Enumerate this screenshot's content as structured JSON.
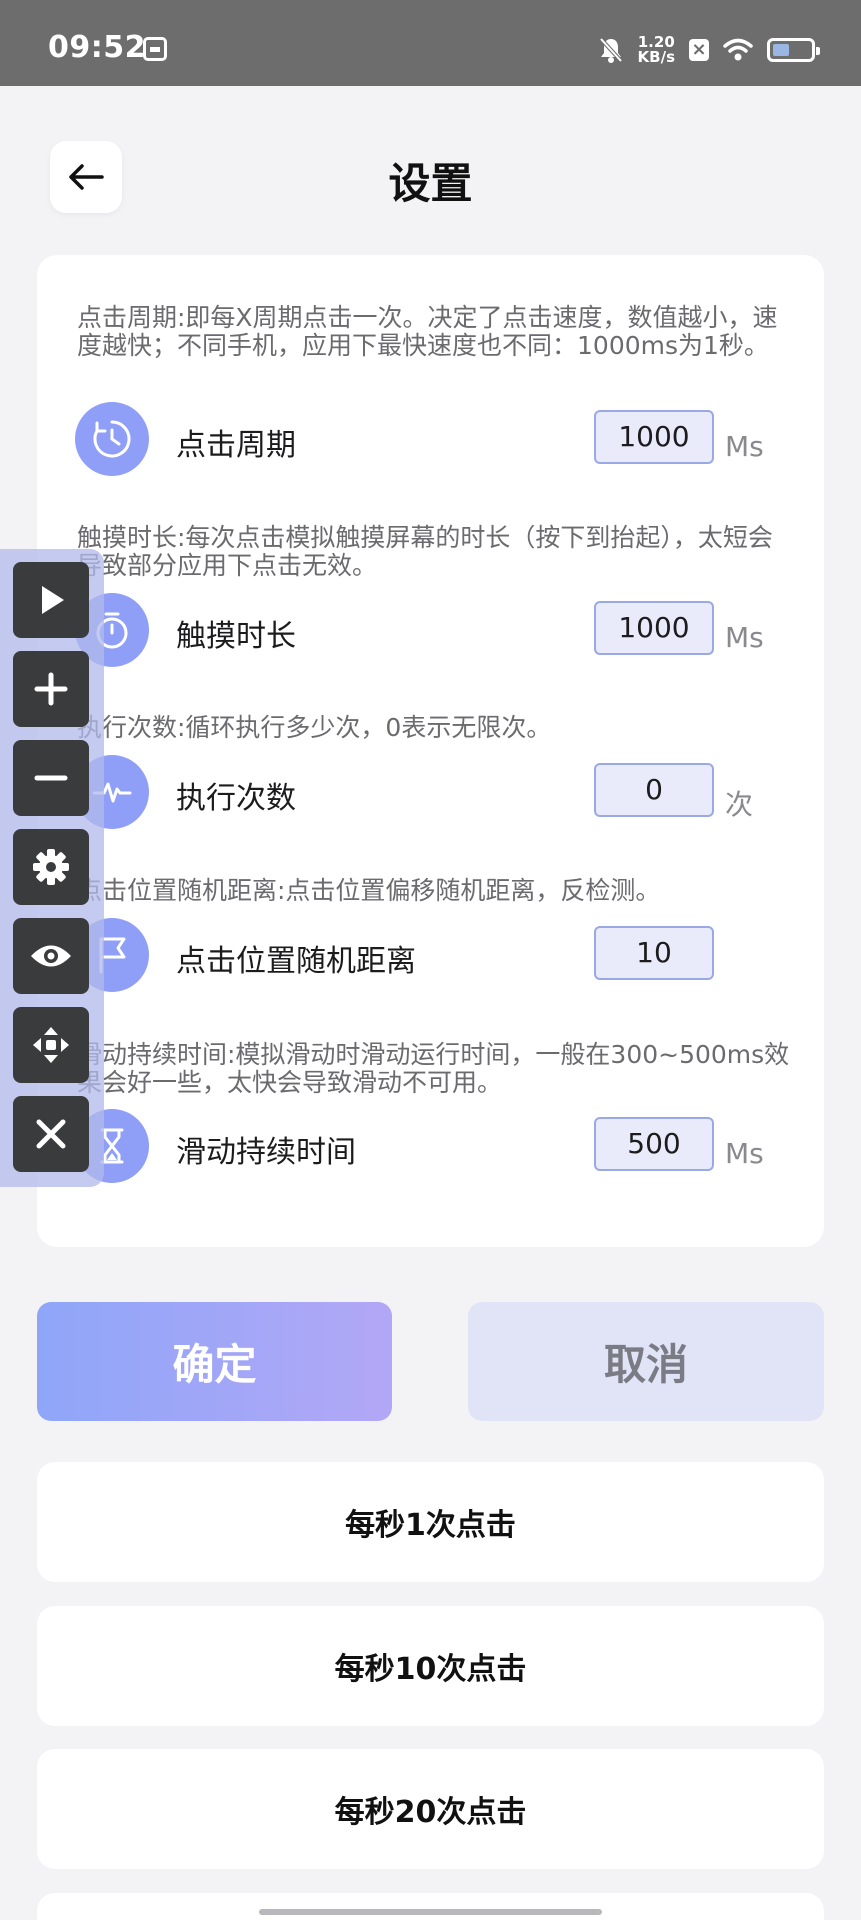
{
  "status_bar": {
    "time": "09:52",
    "net_speed_value": "1.20",
    "net_speed_unit": "KB/s",
    "x_badge": "×",
    "icons": [
      "calendar-icon",
      "bell-off-icon",
      "x-badge-icon",
      "wifi-icon",
      "battery-icon"
    ]
  },
  "header": {
    "back_icon": "arrow-left-icon",
    "title": "设置"
  },
  "settings": [
    {
      "description": "点击周期:即每X周期点击一次。决定了点击速度，数值越小，速度越快；不同手机，应用下最快速度也不同：1000ms为1秒。",
      "icon": "clock-cycle-icon",
      "label": "点击周期",
      "value": "1000",
      "unit": "Ms"
    },
    {
      "description": "触摸时长:每次点击模拟触摸屏幕的时长（按下到抬起），太短会导致部分应用下点击无效。",
      "icon": "stopwatch-icon",
      "label": "触摸时长",
      "value": "1000",
      "unit": "Ms"
    },
    {
      "description": "执行次数:循环执行多少次，0表示无限次。",
      "icon": "pulse-icon",
      "label": "执行次数",
      "value": "0",
      "unit": "次"
    },
    {
      "description": "点击位置随机距离:点击位置偏移随机距离，反检测。",
      "icon": "flag-icon",
      "label": "点击位置随机距离",
      "value": "10",
      "unit": ""
    },
    {
      "description": "滑动持续时间:模拟滑动时滑动运行时间，一般在300~500ms效果会好一些，太快会导致滑动不可用。",
      "icon": "hourglass-icon",
      "label": "滑动持续时间",
      "value": "500",
      "unit": "Ms"
    }
  ],
  "float_toolbar": [
    "play-icon",
    "plus-icon",
    "minus-icon",
    "gear-icon",
    "eye-icon",
    "move-icon",
    "close-icon"
  ],
  "actions": {
    "confirm": "确定",
    "cancel": "取消"
  },
  "presets": [
    "每秒1次点击",
    "每秒10次点击",
    "每秒20次点击"
  ],
  "colors": {
    "accent": "#8f9ff7",
    "confirm_gradient_start": "#8fa6f8",
    "confirm_gradient_end": "#b2a7f6",
    "cancel_bg": "#e1e4f6",
    "input_bg": "#e9ebfb"
  }
}
